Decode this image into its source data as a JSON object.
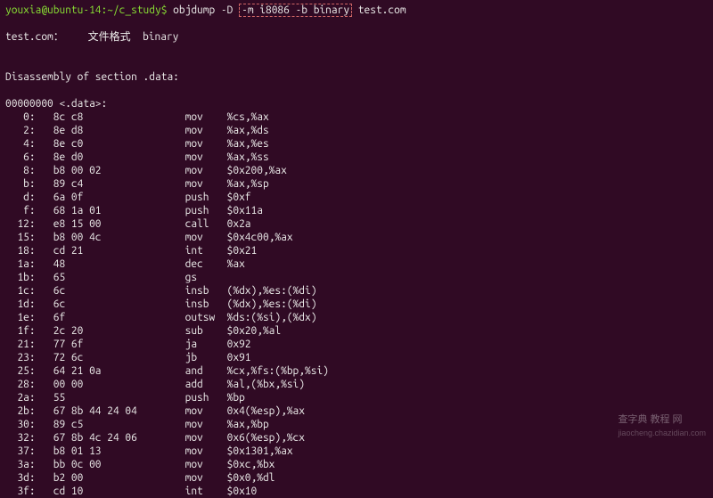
{
  "prompt": "youxia@ubuntu-14:~/c_study$ ",
  "cmd_pre": "objdump -D ",
  "cmd_box": "-m i8086 -b binary",
  "cmd_post": " test.com",
  "file_line": "test.com：    文件格式  binary",
  "disasm_header": "Disassembly of section .data:",
  "section_label": "00000000 <.data>:",
  "rows": [
    {
      "addr": "0",
      "bytes": "8c c8",
      "mn": "mov",
      "ops": "%cs,%ax"
    },
    {
      "addr": "2",
      "bytes": "8e d8",
      "mn": "mov",
      "ops": "%ax,%ds"
    },
    {
      "addr": "4",
      "bytes": "8e c0",
      "mn": "mov",
      "ops": "%ax,%es"
    },
    {
      "addr": "6",
      "bytes": "8e d0",
      "mn": "mov",
      "ops": "%ax,%ss"
    },
    {
      "addr": "8",
      "bytes": "b8 00 02",
      "mn": "mov",
      "ops": "$0x200,%ax"
    },
    {
      "addr": "b",
      "bytes": "89 c4",
      "mn": "mov",
      "ops": "%ax,%sp"
    },
    {
      "addr": "d",
      "bytes": "6a 0f",
      "mn": "push",
      "ops": "$0xf"
    },
    {
      "addr": "f",
      "bytes": "68 1a 01",
      "mn": "push",
      "ops": "$0x11a"
    },
    {
      "addr": "12",
      "bytes": "e8 15 00",
      "mn": "call",
      "ops": "0x2a"
    },
    {
      "addr": "15",
      "bytes": "b8 00 4c",
      "mn": "mov",
      "ops": "$0x4c00,%ax"
    },
    {
      "addr": "18",
      "bytes": "cd 21",
      "mn": "int",
      "ops": "$0x21"
    },
    {
      "addr": "1a",
      "bytes": "48",
      "mn": "dec",
      "ops": "%ax"
    },
    {
      "addr": "1b",
      "bytes": "65",
      "mn": "gs",
      "ops": ""
    },
    {
      "addr": "1c",
      "bytes": "6c",
      "mn": "insb",
      "ops": "(%dx),%es:(%di)"
    },
    {
      "addr": "1d",
      "bytes": "6c",
      "mn": "insb",
      "ops": "(%dx),%es:(%di)"
    },
    {
      "addr": "1e",
      "bytes": "6f",
      "mn": "outsw",
      "ops": "%ds:(%si),(%dx)"
    },
    {
      "addr": "1f",
      "bytes": "2c 20",
      "mn": "sub",
      "ops": "$0x20,%al"
    },
    {
      "addr": "21",
      "bytes": "77 6f",
      "mn": "ja",
      "ops": "0x92"
    },
    {
      "addr": "23",
      "bytes": "72 6c",
      "mn": "jb",
      "ops": "0x91"
    },
    {
      "addr": "25",
      "bytes": "64 21 0a",
      "mn": "and",
      "ops": "%cx,%fs:(%bp,%si)"
    },
    {
      "addr": "28",
      "bytes": "00 00",
      "mn": "add",
      "ops": "%al,(%bx,%si)"
    },
    {
      "addr": "2a",
      "bytes": "55",
      "mn": "push",
      "ops": "%bp"
    },
    {
      "addr": "2b",
      "bytes": "67 8b 44 24 04",
      "mn": "mov",
      "ops": "0x4(%esp),%ax"
    },
    {
      "addr": "30",
      "bytes": "89 c5",
      "mn": "mov",
      "ops": "%ax,%bp"
    },
    {
      "addr": "32",
      "bytes": "67 8b 4c 24 06",
      "mn": "mov",
      "ops": "0x6(%esp),%cx"
    },
    {
      "addr": "37",
      "bytes": "b8 01 13",
      "mn": "mov",
      "ops": "$0x1301,%ax"
    },
    {
      "addr": "3a",
      "bytes": "bb 0c 00",
      "mn": "mov",
      "ops": "$0xc,%bx"
    },
    {
      "addr": "3d",
      "bytes": "b2 00",
      "mn": "mov",
      "ops": "$0x0,%dl"
    },
    {
      "addr": "3f",
      "bytes": "cd 10",
      "mn": "int",
      "ops": "$0x10"
    }
  ],
  "watermark": {
    "top": "查字典  教程 网",
    "bottom": "jiaocheng.chazidian.com"
  }
}
